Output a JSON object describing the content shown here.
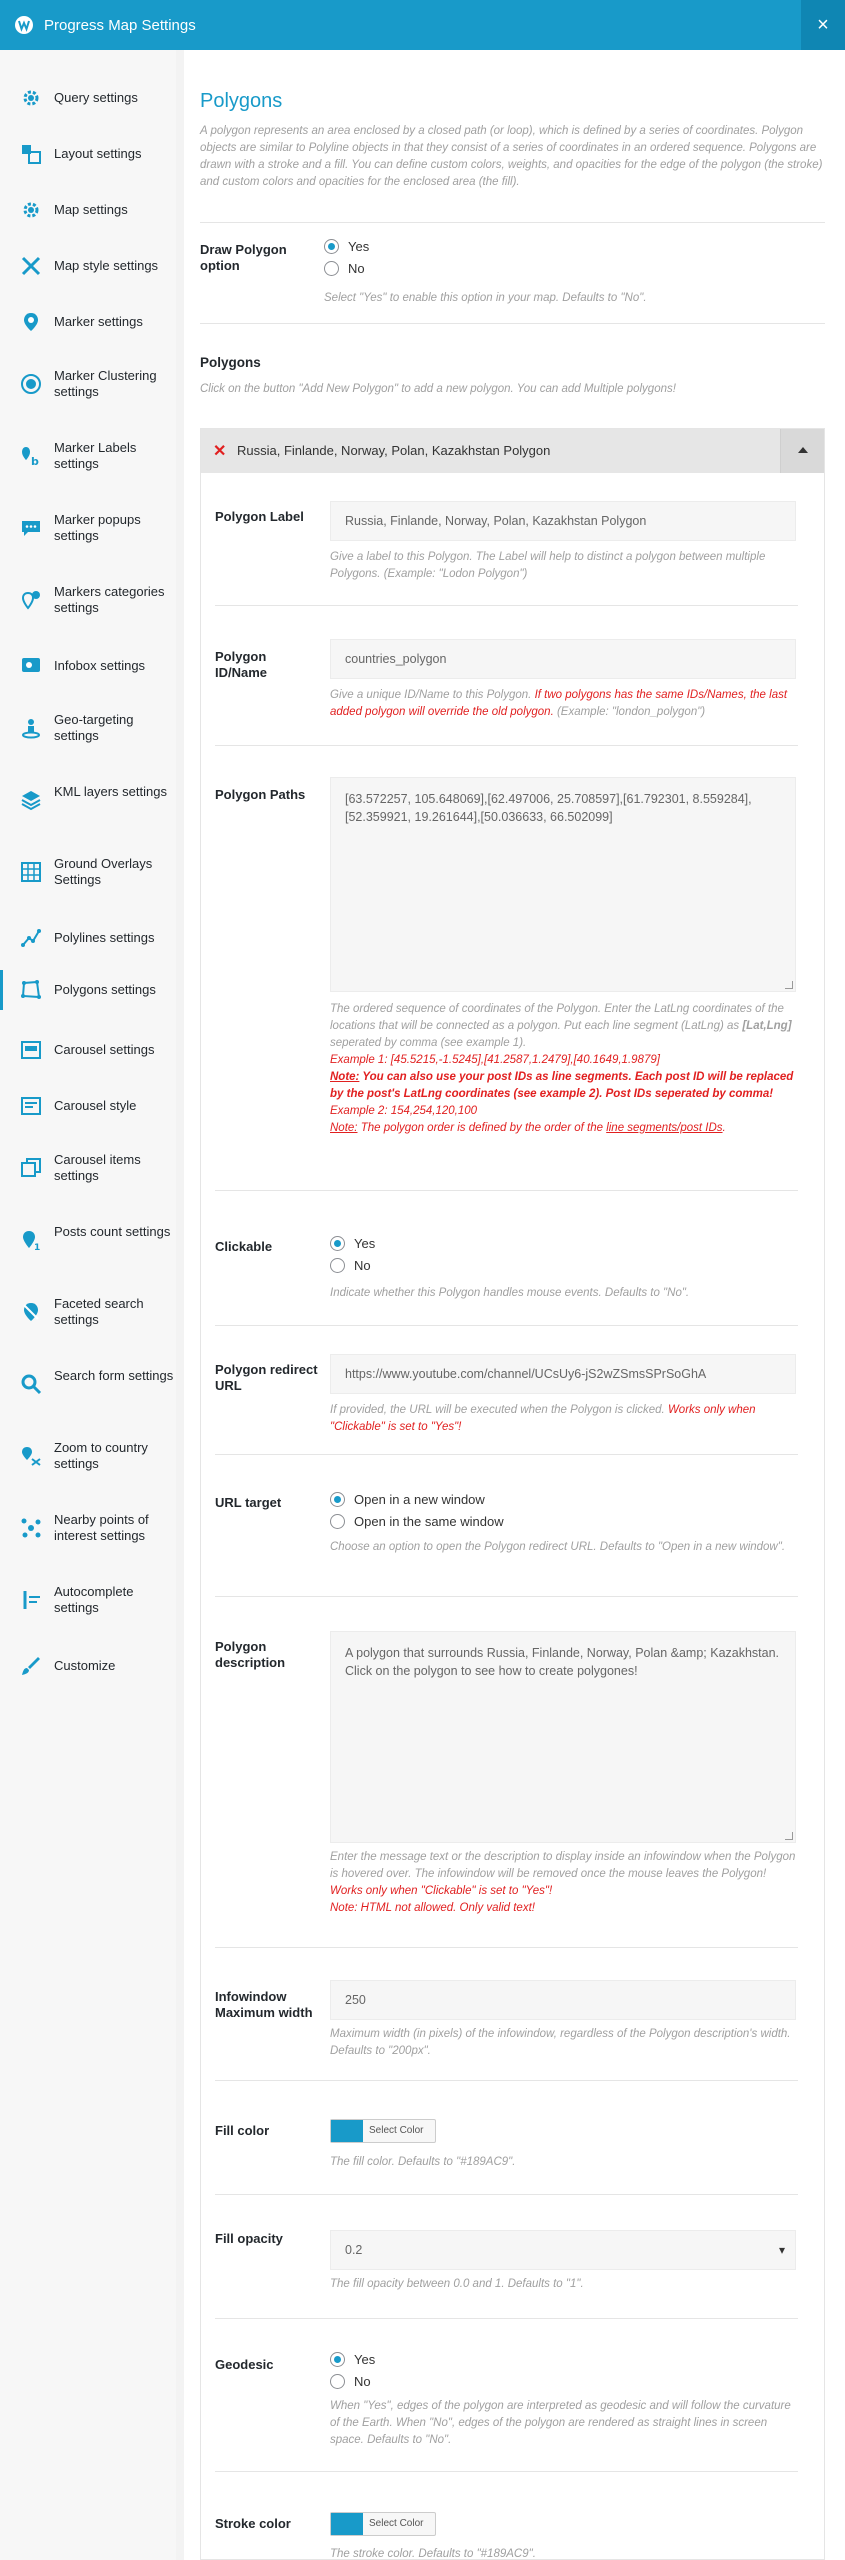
{
  "header": {
    "title": "Progress Map Settings",
    "close": "×"
  },
  "sidebar": {
    "items": [
      {
        "label": "Query settings"
      },
      {
        "label": "Layout settings"
      },
      {
        "label": "Map settings"
      },
      {
        "label": "Map style settings"
      },
      {
        "label": "Marker settings"
      },
      {
        "label": "Marker Clustering settings"
      },
      {
        "label": "Marker Labels settings"
      },
      {
        "label": "Marker popups settings"
      },
      {
        "label": "Markers categories settings"
      },
      {
        "label": "Infobox settings"
      },
      {
        "label": "Geo-targeting settings"
      },
      {
        "label": "KML layers settings"
      },
      {
        "label": "Ground Overlays Settings"
      },
      {
        "label": "Polylines settings"
      },
      {
        "label": "Polygons settings"
      },
      {
        "label": "Carousel settings"
      },
      {
        "label": "Carousel style"
      },
      {
        "label": "Carousel items settings"
      },
      {
        "label": "Posts count settings"
      },
      {
        "label": "Faceted search settings"
      },
      {
        "label": "Search form settings"
      },
      {
        "label": "Zoom to country settings"
      },
      {
        "label": "Nearby points of interest settings"
      },
      {
        "label": "Autocomplete settings"
      },
      {
        "label": "Customize"
      }
    ]
  },
  "main": {
    "title": "Polygons",
    "intro": "A polygon represents an area enclosed by a closed path (or loop), which is defined by a series of coordinates. Polygon objects are similar to Polyline objects in that they consist of a series of coordinates in an ordered sequence. Polygons are drawn with a stroke and a fill. You can define custom colors, weights, and opacities for the edge of the polygon (the stroke) and custom colors and opacities for the enclosed area (the fill).",
    "draw_option": {
      "label": "Draw Polygon option",
      "yes": "Yes",
      "no": "No",
      "help": "Select \"Yes\" to enable this option in your map. Defaults to \"No\"."
    },
    "polygons_section": {
      "title": "Polygons",
      "help": "Click on the button \"Add New Polygon\" to add a new polygon. You can add Multiple polygons!"
    },
    "group": {
      "title": "Russia, Finlande, Norway, Polan, Kazakhstan Polygon",
      "remove": "✕",
      "label": {
        "name": "Polygon Label",
        "value": "Russia, Finlande, Norway, Polan, Kazakhstan Polygon",
        "help": "Give a label to this Polygon. The Label will help to distinct a polygon between multiple Polygons. (Example: \"Lodon Polygon\")"
      },
      "id": {
        "name": "Polygon ID/Name",
        "value": "countries_polygon",
        "help_a": "Give a unique ID/Name to this Polygon. ",
        "help_b": "If two polygons has the same IDs/Names, the last added polygon will override the old polygon.",
        "help_c": " (Example: \"london_polygon\")"
      },
      "paths": {
        "name": "Polygon Paths",
        "value": "[63.572257, 105.648069],[62.497006, 25.708597],[61.792301, 8.559284],[52.359921, 19.261644],[50.036633, 66.502099]",
        "help_1": "The ordered sequence of coordinates of the Polygon. Enter the LatLng coordinates of the locations that will be connected as a polygon. Put each line segment (LatLng) as ",
        "help_1b": "[Lat,Lng]",
        "help_1c": " seperated by comma (see example 1).",
        "example1": "Example 1: [45.5215,-1.5245],[41.2587,1.2479],[40.1649,1.9879]",
        "note1_label": "Note:",
        "note1": " You can also use your post IDs as line segments. Each post ID will be replaced by the post's LatLng coordinates (see example 2). Post IDs seperated by comma!",
        "example2": "Example 2: 154,254,120,100",
        "note2_label": "Note:",
        "note2_a": " The polygon order is defined by the order of the ",
        "note2_link": "line segments/post IDs",
        "note2_b": "."
      },
      "clickable": {
        "name": "Clickable",
        "yes": "Yes",
        "no": "No",
        "help": "Indicate whether this Polygon handles mouse events. Defaults to \"No\"."
      },
      "redirect": {
        "name": "Polygon redirect URL",
        "value": "https://www.youtube.com/channel/UCsUy6-jS2wZSmsSPrSoGhA",
        "help_a": "If provided, the URL will be executed when the Polygon is clicked. ",
        "help_b": "Works only when \"Clickable\" is set to \"Yes\"!"
      },
      "target": {
        "name": "URL target",
        "opt1": "Open in a new window",
        "opt2": "Open in the same window",
        "help": "Choose an option to open the Polygon redirect URL. Defaults to \"Open in a new window\"."
      },
      "description": {
        "name": "Polygon description",
        "value": "A polygon that surrounds Russia, Finlande, Norway, Polan &amp; Kazakhstan. Click on the polygon to see how to create polygones!",
        "help_a": "Enter the message text or the description to display inside an infowindow when the Polygon is hovered over. The infowindow will be removed once the mouse leaves the Polygon! ",
        "help_b": "Works only when \"Clickable\" is set to \"Yes\"!",
        "help_c": "Note: HTML not allowed. Only valid text!"
      },
      "infowindow": {
        "name": "Infowindow Maximum width",
        "value": "250",
        "help": "Maximum width (in pixels) of the infowindow, regardless of the Polygon description's width. Defaults to \"200px\"."
      },
      "fill_color": {
        "name": "Fill color",
        "button": "Select Color",
        "color": "#189AC9",
        "help": "The fill color. Defaults to \"#189AC9\"."
      },
      "fill_opacity": {
        "name": "Fill opacity",
        "value": "0.2",
        "help": "The fill opacity between 0.0 and 1. Defaults to \"1\"."
      },
      "geodesic": {
        "name": "Geodesic",
        "yes": "Yes",
        "no": "No",
        "help": "When \"Yes\", edges of the polygon are interpreted as geodesic and will follow the curvature of the Earth. When \"No\", edges of the polygon are rendered as straight lines in screen space. Defaults to \"No\"."
      },
      "stroke_color": {
        "name": "Stroke color",
        "button": "Select Color",
        "color": "#189AC9",
        "help": "The stroke color. Defaults to \"#189AC9\"."
      }
    }
  }
}
